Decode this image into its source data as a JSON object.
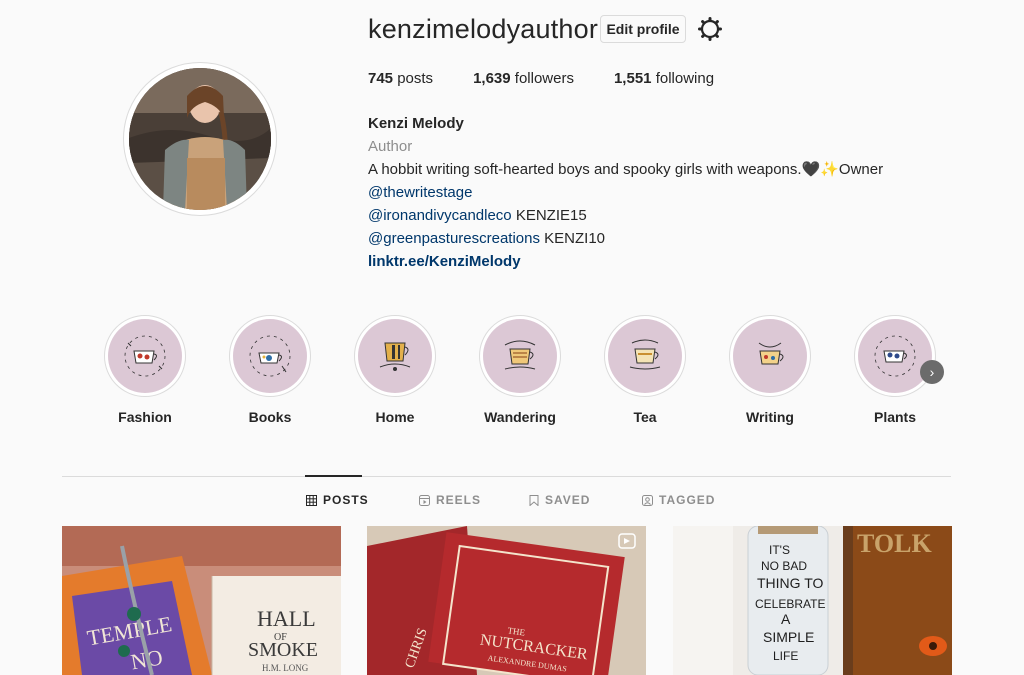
{
  "profile": {
    "username": "kenzimelodyauthor",
    "edit_label": "Edit profile",
    "stats": {
      "posts_count": "745",
      "posts_label": "posts",
      "followers_count": "1,639",
      "followers_label": "followers",
      "following_count": "1,551",
      "following_label": "following"
    },
    "bio": {
      "name": "Kenzi Melody",
      "category": "Author",
      "line1": "A hobbit writing soft-hearted boys and spooky girls with weapons.🖤✨Owner",
      "mention1": "@thewritestage",
      "mention2": "@ironandivycandleco",
      "code2": " KENZIE15",
      "mention3": "@greenpasturescreations",
      "code3": " KENZI10",
      "link": "linktr.ee/KenziMelody"
    }
  },
  "highlights": [
    {
      "label": "Fashion"
    },
    {
      "label": "Books"
    },
    {
      "label": "Home"
    },
    {
      "label": "Wandering"
    },
    {
      "label": "Tea"
    },
    {
      "label": "Writing"
    },
    {
      "label": "Plants"
    }
  ],
  "tabs": {
    "posts": "POSTS",
    "reels": "REELS",
    "saved": "SAVED",
    "tagged": "TAGGED"
  },
  "posts": [
    {
      "book1": "TEMPLE",
      "book1b": "NO",
      "book2": "HALL",
      "book2b": "OF",
      "book2c": "SMOKE",
      "author2": "H.M. LONG"
    },
    {
      "book1": "THE",
      "book1b": "NUTCRACKER",
      "author1": "ALEXANDRE DUMAS",
      "spine": "CHRIS"
    },
    {
      "jar_lines": [
        "IT'S",
        "NO BAD",
        "THING TO",
        "CELEBRATE",
        "A",
        "SIMPLE",
        "LIFE"
      ],
      "spine": "TOLK"
    }
  ],
  "colors": {
    "accent_link": "#00376b",
    "highlight_bg": "#dcc8d5",
    "border": "#dbdbdb"
  }
}
